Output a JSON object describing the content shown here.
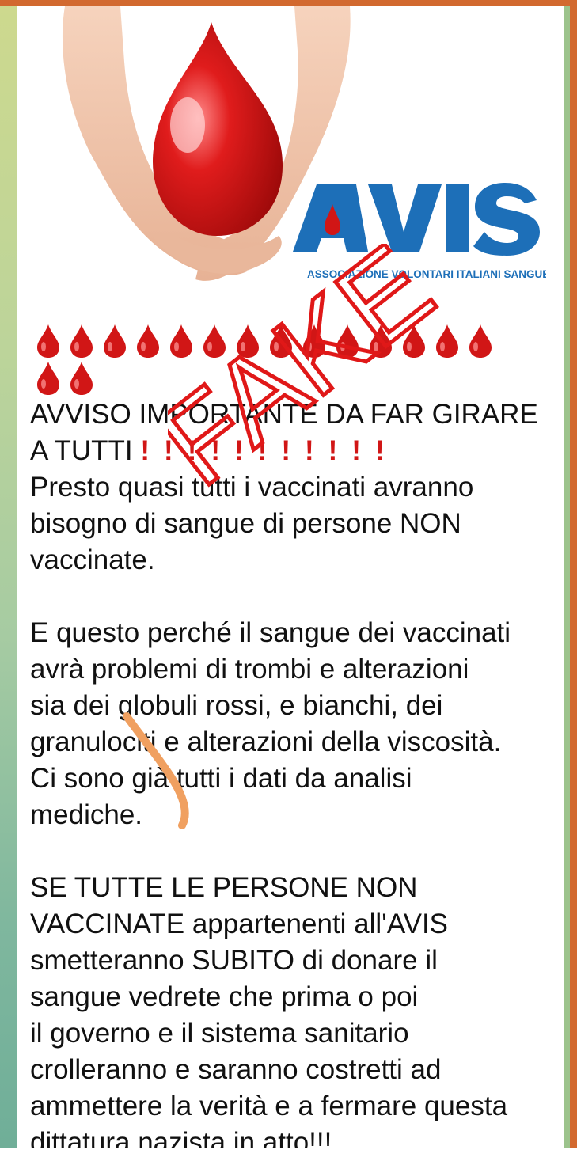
{
  "logo": {
    "brand": "AVIS",
    "tagline": "ASSOCIAZIONE VOLONTARI ITALIANI SANGUE"
  },
  "drops": {
    "icon": "blood-drop-icon",
    "row1_count": 14,
    "row2_count": 2,
    "color": "#d11616"
  },
  "stamp": {
    "text": "FAKE",
    "color": "#e01818"
  },
  "message": {
    "heading_line1": "AVVISO IMPORTANTE DA FAR GIRARE",
    "heading_line2": "A TUTTI",
    "exclamations": "!!!!!!!!!!!",
    "p1_line1": "Presto quasi tutti i vaccinati avranno",
    "p1_line2": "bisogno di sangue di persone NON",
    "p1_line3": "vaccinate.",
    "p2_line1": "E questo perché il sangue dei vaccinati",
    "p2_line2": "avrà problemi di trombi e alterazioni",
    "p2_line3": "sia dei globuli rossi, e bianchi, dei",
    "p2_line4": "granulociti e alterazioni della viscosità.",
    "p2_line5": "Ci sono già tutti i dati da analisi",
    "p2_line6": "mediche.",
    "p3_line1": "SE TUTTE LE PERSONE NON",
    "p3_line2": "VACCINATE appartenenti all'AVIS",
    "p3_line3": "smetteranno SUBITO di donare il",
    "p3_line4": "sangue vedrete che prima o poi",
    "p3_line5": "il governo e il sistema sanitario",
    "p3_line6": "crolleranno e saranno costretti ad",
    "p3_line7": "ammettere la verità e a fermare questa",
    "p3_line8": "dittatura nazista in atto!!!"
  },
  "colors": {
    "frame_orange": "#d2692f",
    "frame_green": "#a6cba2",
    "avis_blue": "#1d6fb8",
    "blood_red": "#d11616",
    "scribble_orange": "#f0a060"
  }
}
